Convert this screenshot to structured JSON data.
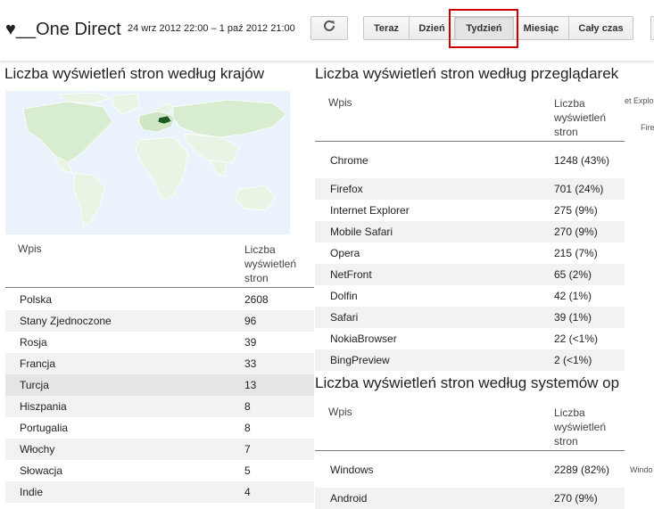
{
  "header": {
    "blog_title": "♥__One Direct",
    "date_range": "24 wrz 2012 22:00 – 1 paź 2012 21:00",
    "refresh_icon": "refresh-icon",
    "ranges": [
      "Teraz",
      "Dzień",
      "Tydzień",
      "Miesiąc",
      "Cały czas"
    ],
    "active_range": "Tydzień"
  },
  "countries": {
    "title": "Liczba wyświetleń stron według krajów",
    "col_entry": "Wpis",
    "col_views": "Liczba wyświetleń stron",
    "rows": [
      {
        "name": "Polska",
        "value": "2608"
      },
      {
        "name": "Stany Zjednoczone",
        "value": "96"
      },
      {
        "name": "Rosja",
        "value": "39"
      },
      {
        "name": "Francja",
        "value": "33"
      },
      {
        "name": "Turcja",
        "value": "13"
      },
      {
        "name": "Hiszpania",
        "value": "8"
      },
      {
        "name": "Portugalia",
        "value": "8"
      },
      {
        "name": "Włochy",
        "value": "7"
      },
      {
        "name": "Słowacja",
        "value": "5"
      },
      {
        "name": "Indie",
        "value": "4"
      }
    ]
  },
  "browsers": {
    "title": "Liczba wyświetleń stron według przeglądarek",
    "col_entry": "Wpis",
    "col_views": "Liczba wyświetleń stron",
    "rows": [
      {
        "name": "Chrome",
        "value": "1248 (43%)"
      },
      {
        "name": "Firefox",
        "value": "701 (24%)"
      },
      {
        "name": "Internet Explorer",
        "value": "275 (9%)"
      },
      {
        "name": "Mobile Safari",
        "value": "270 (9%)"
      },
      {
        "name": "Opera",
        "value": "215 (7%)"
      },
      {
        "name": "NetFront",
        "value": "65 (2%)"
      },
      {
        "name": "Dolfin",
        "value": "42 (1%)"
      },
      {
        "name": "Safari",
        "value": "39 (1%)"
      },
      {
        "name": "NokiaBrowser",
        "value": "22 (<1%)"
      },
      {
        "name": "BingPreview",
        "value": "2 (<1%)"
      }
    ],
    "pie_labels": [
      "et Explo",
      "Fire"
    ]
  },
  "os": {
    "title": "Liczba wyświetleń stron według systemów op",
    "col_entry": "Wpis",
    "col_views": "Liczba wyświetleń stron",
    "rows": [
      {
        "name": "Windows",
        "value": "2289 (82%)"
      },
      {
        "name": "Android",
        "value": "270 (9%)"
      }
    ],
    "pie_labels": [
      "Windo"
    ]
  }
}
